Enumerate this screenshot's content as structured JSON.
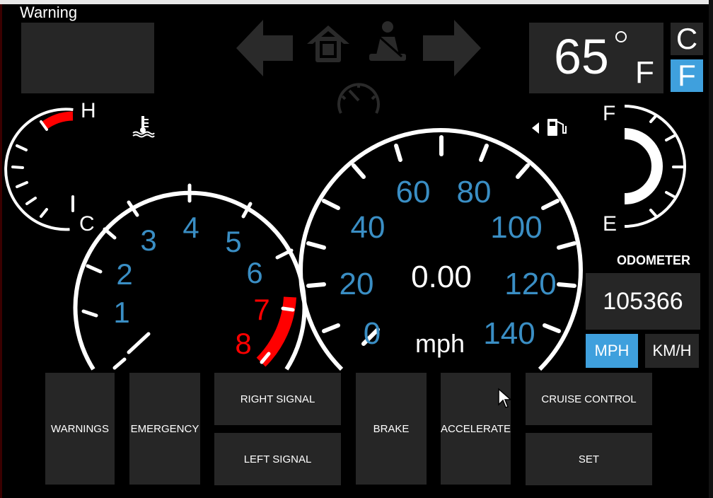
{
  "warning": {
    "title": "Warning"
  },
  "temperature": {
    "value": "65",
    "unit": "F",
    "options": [
      "C",
      "F"
    ],
    "selected": "F"
  },
  "coolant_gauge": {
    "hot_label": "H",
    "cold_label": "C"
  },
  "fuel_gauge": {
    "full_label": "F",
    "empty_label": "E"
  },
  "tachometer": {
    "labels": [
      "1",
      "2",
      "3",
      "4",
      "5",
      "6",
      "7",
      "8"
    ],
    "redline_labels": [
      "7",
      "8"
    ]
  },
  "speedometer": {
    "labels": [
      "0",
      "20",
      "40",
      "60",
      "80",
      "100",
      "120",
      "140"
    ],
    "speed": "0.00",
    "unit": "mph"
  },
  "odometer": {
    "title": "ODOMETER",
    "value": "105366"
  },
  "speed_units": {
    "mph": "MPH",
    "kmh": "KM/H",
    "selected": "MPH"
  },
  "controls": {
    "warnings": "WARNINGS",
    "emergency": "EMERGENCY",
    "right_signal": "RIGHT SIGNAL",
    "left_signal": "LEFT SIGNAL",
    "brake": "BRAKE",
    "accelerate": "ACCELERATE",
    "cruise_control": "CRUISE CONTROL",
    "set": "SET"
  },
  "colors": {
    "accent": "#3fa0dd",
    "gauge_number": "#3a8ec4",
    "redline": "#ff0000",
    "inactive_icon": "#2a2a2a",
    "panel": "#262626"
  },
  "icons": [
    "left-arrow-icon",
    "door-open-icon",
    "seatbelt-icon",
    "right-arrow-icon",
    "cruise-gauge-icon",
    "coolant-temperature-icon",
    "fuel-pump-icon"
  ]
}
